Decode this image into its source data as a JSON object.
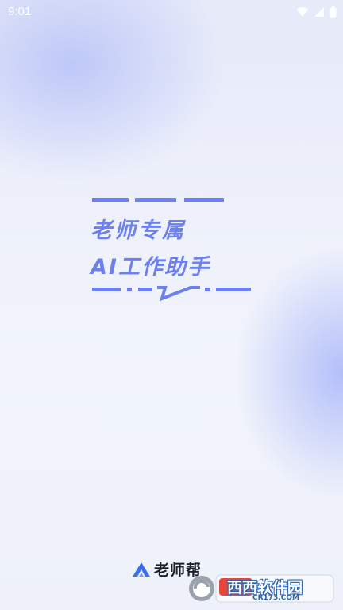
{
  "status_bar": {
    "time": "9:01",
    "icons": [
      "wifi-icon",
      "signal-icon",
      "battery-icon"
    ]
  },
  "slogan": {
    "line1": "老师专属",
    "line2": "AI工作助手"
  },
  "brand": {
    "logo_icon": "brand-logo-icon",
    "name": "老师帮"
  },
  "watermark": {
    "text": "西西软件园",
    "url": "CR173.COM"
  },
  "colors": {
    "accent": "#6c80ef",
    "brand_text": "#1d1f2b",
    "logo": "#3a6ff2"
  }
}
